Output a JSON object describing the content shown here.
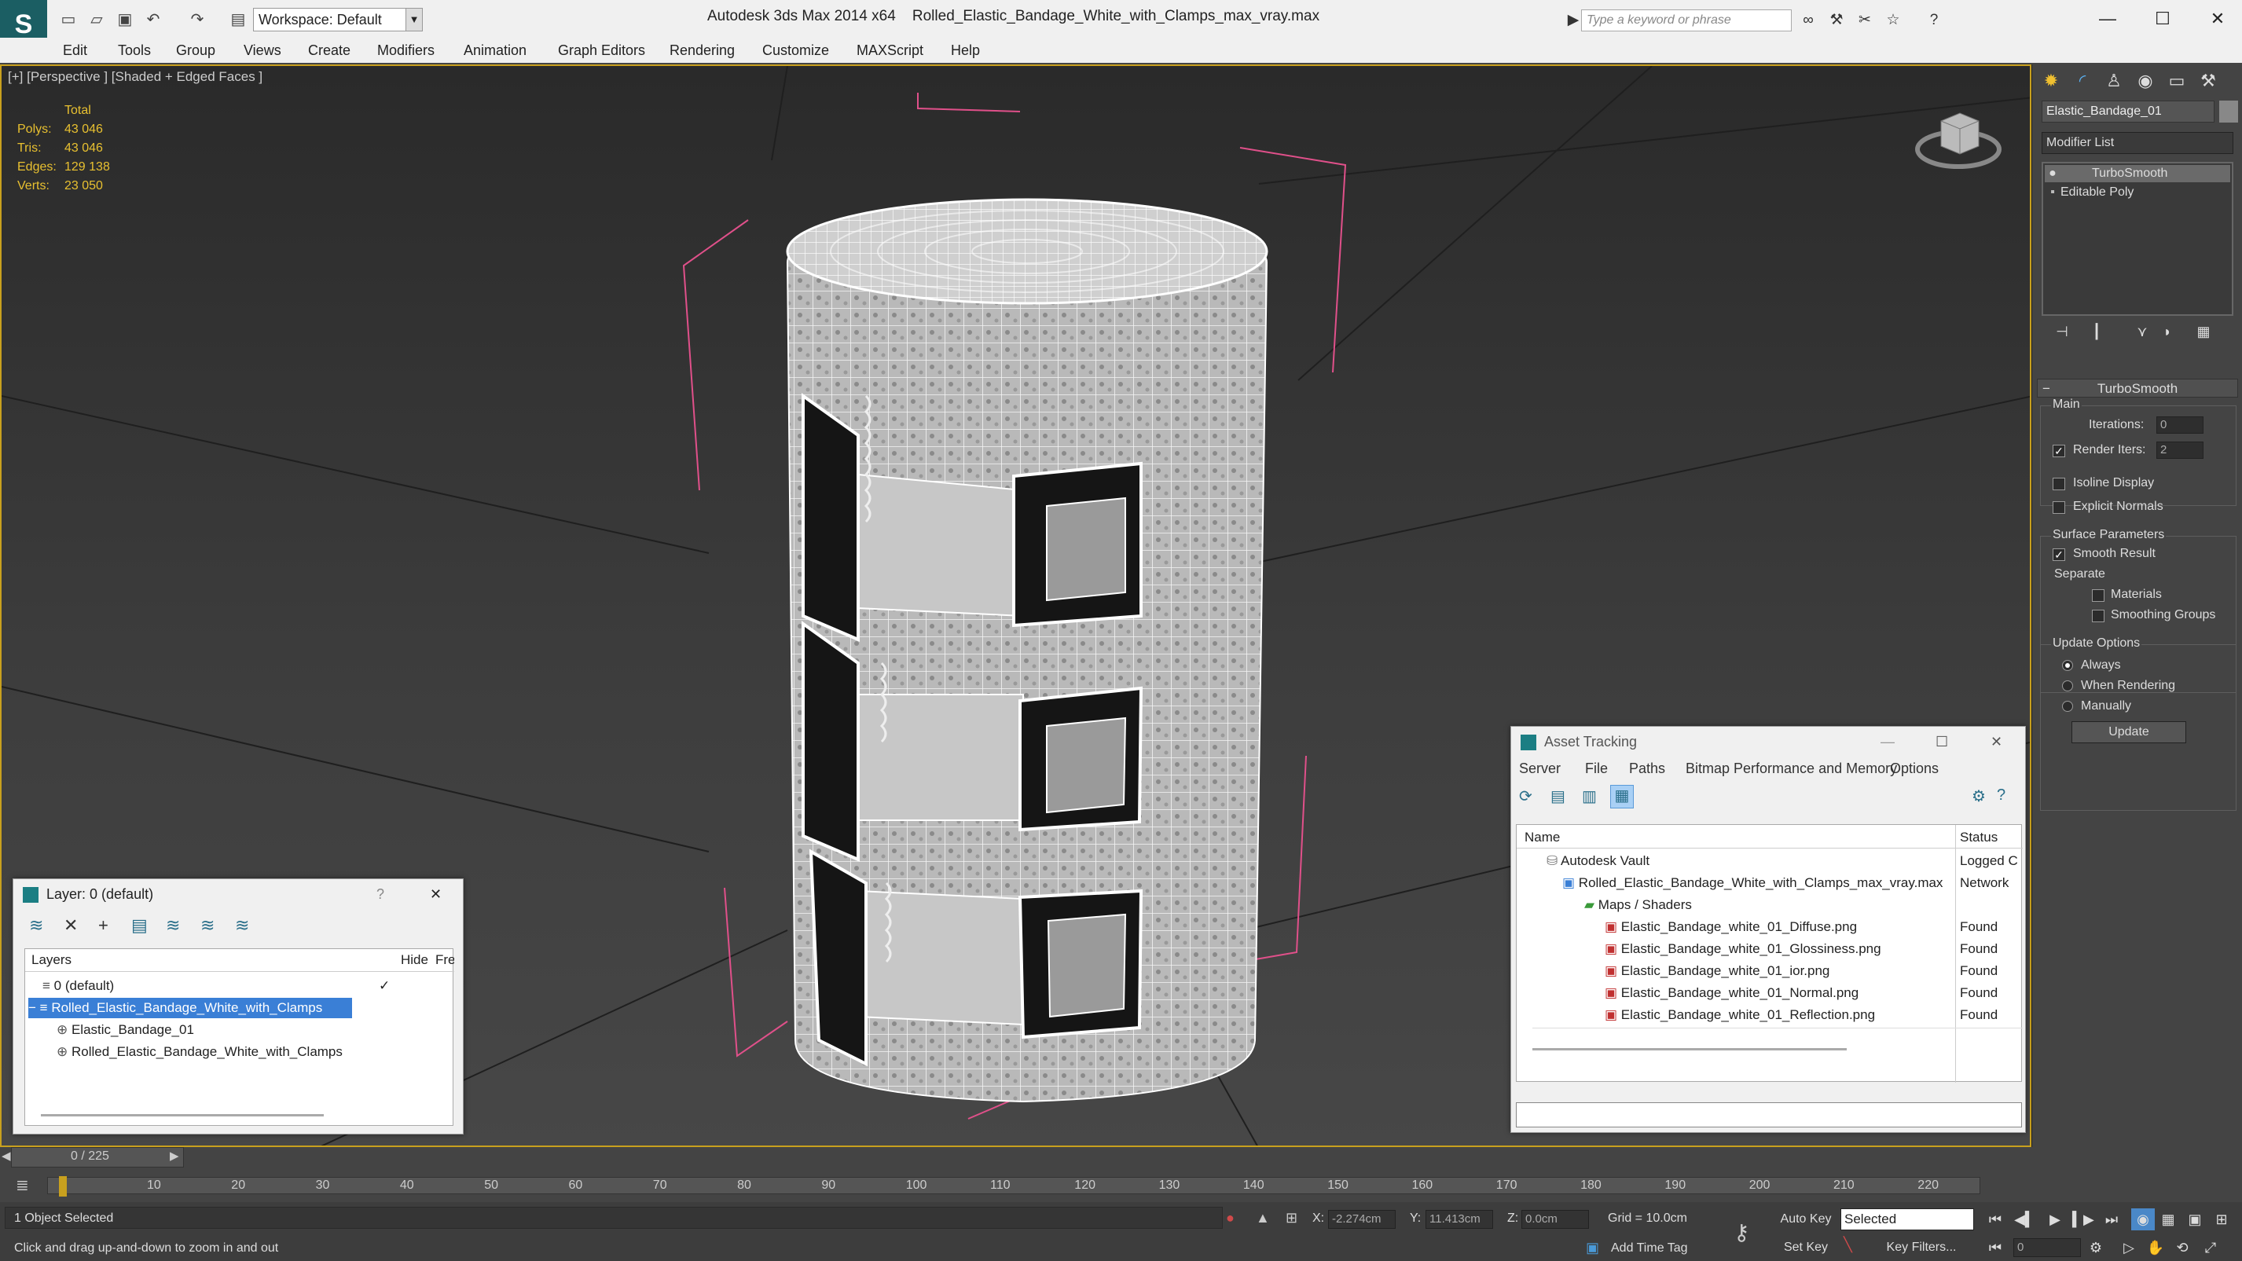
{
  "titlebar": {
    "workspace": "Workspace: Default",
    "app": "Autodesk 3ds Max  2014 x64",
    "file": "Rolled_Elastic_Bandage_White_with_Clamps_max_vray.max",
    "search_placeholder": "Type a keyword or phrase"
  },
  "menu": [
    "Edit",
    "Tools",
    "Group",
    "Views",
    "Create",
    "Modifiers",
    "Animation",
    "Graph Editors",
    "Rendering",
    "Customize",
    "MAXScript",
    "Help"
  ],
  "viewport": {
    "label": "[+] [Perspective ] [Shaded + Edged Faces ]",
    "stats": {
      "header": "Total",
      "rows": [
        {
          "k": "Polys:",
          "v": "43 046"
        },
        {
          "k": "Tris:",
          "v": "43 046"
        },
        {
          "k": "Edges:",
          "v": "129 138"
        },
        {
          "k": "Verts:",
          "v": "23 050"
        }
      ]
    }
  },
  "command_panel": {
    "object_name": "Elastic_Bandage_01",
    "modifier_list": "Modifier List",
    "stack": [
      "TurboSmooth",
      "Editable Poly"
    ],
    "turbosmooth": {
      "title": "TurboSmooth",
      "main": "Main",
      "iterations_label": "Iterations:",
      "iterations": "0",
      "render_iters_label": "Render Iters:",
      "render_iters": "2",
      "isoline": "Isoline Display",
      "explicit": "Explicit Normals",
      "surface": "Surface Parameters",
      "smooth_result": "Smooth Result",
      "separate": "Separate",
      "materials": "Materials",
      "smoothing_groups": "Smoothing Groups",
      "update_options": "Update Options",
      "always": "Always",
      "when_rendering": "When Rendering",
      "manually": "Manually",
      "update": "Update"
    }
  },
  "layer_dialog": {
    "title": "Layer: 0 (default)",
    "help": "?",
    "col_layers": "Layers",
    "col_hide": "Hide",
    "col_freeze": "Freez",
    "rows": [
      "0 (default)",
      "Rolled_Elastic_Bandage_White_with_Clamps",
      "Elastic_Bandage_01",
      "Rolled_Elastic_Bandage_White_with_Clamps"
    ]
  },
  "asset_tracking": {
    "title": "Asset Tracking",
    "menu": [
      "Server",
      "File",
      "Paths",
      "Bitmap Performance and Memory",
      "Options"
    ],
    "col_name": "Name",
    "col_status": "Status",
    "rows": [
      {
        "name": "Autodesk Vault",
        "status": "Logged C"
      },
      {
        "name": "Rolled_Elastic_Bandage_White_with_Clamps_max_vray.max",
        "status": "Network"
      },
      {
        "name": "Maps / Shaders",
        "status": ""
      },
      {
        "name": "Elastic_Bandage_white_01_Diffuse.png",
        "status": "Found"
      },
      {
        "name": "Elastic_Bandage_white_01_Glossiness.png",
        "status": "Found"
      },
      {
        "name": "Elastic_Bandage_white_01_ior.png",
        "status": "Found"
      },
      {
        "name": "Elastic_Bandage_white_01_Normal.png",
        "status": "Found"
      },
      {
        "name": "Elastic_Bandage_white_01_Reflection.png",
        "status": "Found"
      }
    ]
  },
  "timeline": {
    "frame": "0 / 225",
    "ticks": [
      "10",
      "20",
      "30",
      "40",
      "50",
      "60",
      "70",
      "80",
      "90",
      "100",
      "110",
      "120",
      "130",
      "140",
      "150",
      "160",
      "170",
      "180",
      "190",
      "200",
      "210",
      "220"
    ]
  },
  "status": {
    "selected": "1 Object Selected",
    "prompt": "Click and drag up-and-down to zoom in and out",
    "x_label": "X:",
    "x": "-2.274cm",
    "y_label": "Y:",
    "y": "11.413cm",
    "z_label": "Z:",
    "z": "0.0cm",
    "grid": "Grid = 10.0cm",
    "auto_key": "Auto Key",
    "set_key": "Set Key",
    "selected_dropdown": "Selected",
    "key_filters": "Key Filters...",
    "add_time_tag": "Add Time Tag",
    "frame_field": "0"
  }
}
